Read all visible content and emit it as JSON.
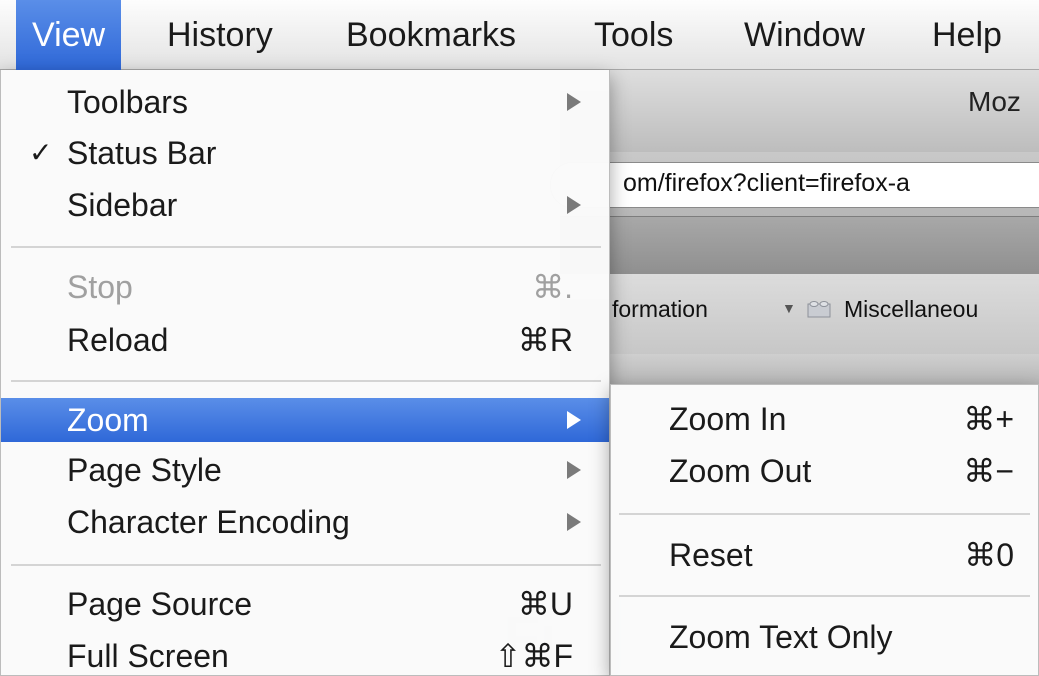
{
  "menubar": {
    "items": [
      "View",
      "History",
      "Bookmarks",
      "Tools",
      "Window",
      "Help"
    ],
    "active": "View"
  },
  "window": {
    "title": "Moz",
    "url": "om/firefox?client=firefox-a",
    "bookmarks": [
      "formation",
      "Miscellaneou"
    ]
  },
  "view_menu": {
    "items": [
      {
        "label": "Toolbars",
        "submenu": true
      },
      {
        "label": "Status Bar",
        "checked": true
      },
      {
        "label": "Sidebar",
        "submenu": true
      },
      {
        "label": "Stop",
        "shortcut": "⌘.",
        "disabled": true
      },
      {
        "label": "Reload",
        "shortcut": "⌘R"
      },
      {
        "label": "Zoom",
        "submenu": true,
        "highlighted": true
      },
      {
        "label": "Page Style",
        "submenu": true
      },
      {
        "label": "Character Encoding",
        "submenu": true
      },
      {
        "label": "Page Source",
        "shortcut": "⌘U"
      },
      {
        "label": "Full Screen",
        "shortcut": "⇧⌘F"
      }
    ]
  },
  "zoom_menu": {
    "items": [
      {
        "label": "Zoom In",
        "shortcut": "⌘+"
      },
      {
        "label": "Zoom Out",
        "shortcut": "⌘−"
      },
      {
        "label": "Reset",
        "shortcut": "⌘0"
      },
      {
        "label": "Zoom Text Only"
      }
    ]
  },
  "colors": {
    "highlight": "#3a74dc",
    "menu_bg": "#fafafa",
    "disabled_text": "#a0a0a0"
  }
}
